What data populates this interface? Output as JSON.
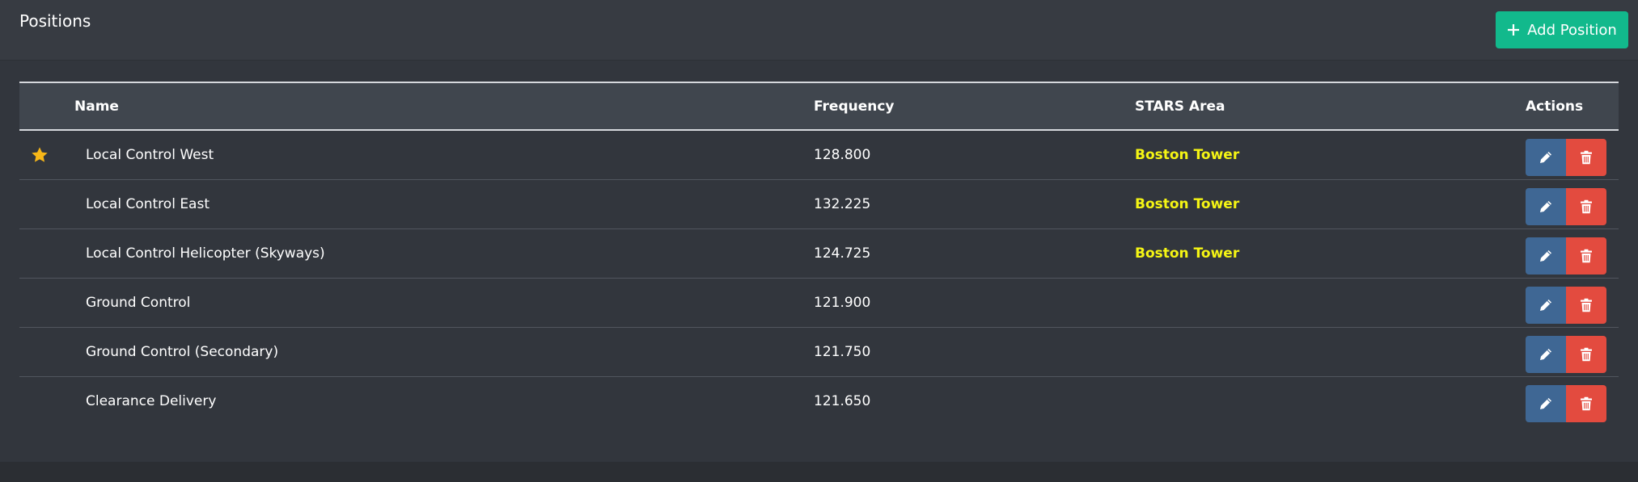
{
  "header": {
    "title": "Positions",
    "add_button_label": "Add Position"
  },
  "table": {
    "columns": {
      "name": "Name",
      "frequency": "Frequency",
      "stars_area": "STARS Area",
      "actions": "Actions"
    },
    "rows": [
      {
        "name": "Local Control West",
        "frequency": "128.800",
        "stars_area": "Boston Tower",
        "starred": true
      },
      {
        "name": "Local Control East",
        "frequency": "132.225",
        "stars_area": "Boston Tower",
        "starred": false
      },
      {
        "name": "Local Control Helicopter (Skyways)",
        "frequency": "124.725",
        "stars_area": "Boston Tower",
        "starred": false
      },
      {
        "name": "Ground Control",
        "frequency": "121.900",
        "stars_area": "",
        "starred": false
      },
      {
        "name": "Ground Control (Secondary)",
        "frequency": "121.750",
        "stars_area": "",
        "starred": false
      },
      {
        "name": "Clearance Delivery",
        "frequency": "121.650",
        "stars_area": "",
        "starred": false
      }
    ]
  },
  "colors": {
    "add_button": "#12b98c",
    "edit_button": "#3f6794",
    "delete_button": "#e34b3f",
    "star": "#f7b718",
    "stars_area_text": "#f5f514"
  },
  "icons": {
    "add": "plus-icon",
    "star": "star-icon",
    "edit": "pencil-icon",
    "delete": "trash-icon"
  }
}
